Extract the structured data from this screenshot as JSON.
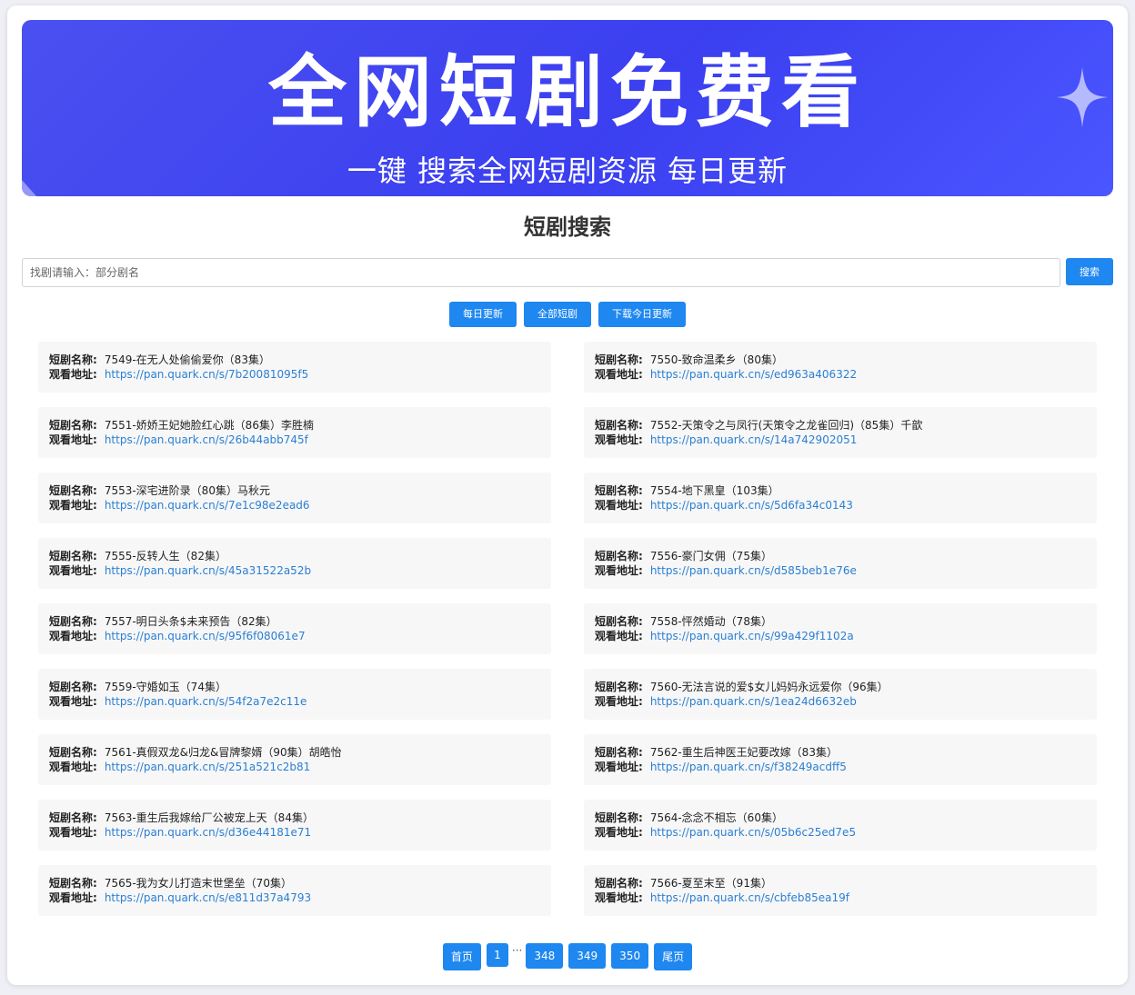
{
  "banner": {
    "title": "全网短剧免费看",
    "subtitle": "一键 搜索全网短剧资源 每日更新"
  },
  "page_title": "短剧搜索",
  "search": {
    "placeholder": "找剧请输入：部分剧名",
    "button_label": "搜索"
  },
  "filters": [
    {
      "label": "每日更新"
    },
    {
      "label": "全部短剧"
    },
    {
      "label": "下载今日更新"
    }
  ],
  "labels": {
    "name": "短剧名称:",
    "address": "观看地址:"
  },
  "items": [
    {
      "title": "7549-在无人处偷偷爱你（83集）",
      "url": "https://pan.quark.cn/s/7b20081095f5"
    },
    {
      "title": "7550-致命温柔乡（80集）",
      "url": "https://pan.quark.cn/s/ed963a406322"
    },
    {
      "title": "7551-娇娇王妃她脸红心跳（86集）李胜楠",
      "url": "https://pan.quark.cn/s/26b44abb745f"
    },
    {
      "title": "7552-天策令之与凤行(天策令之龙雀回归)（85集）千歆",
      "url": "https://pan.quark.cn/s/14a742902051"
    },
    {
      "title": "7553-深宅进阶录（80集）马秋元",
      "url": "https://pan.quark.cn/s/7e1c98e2ead6"
    },
    {
      "title": "7554-地下黑皇（103集）",
      "url": "https://pan.quark.cn/s/5d6fa34c0143"
    },
    {
      "title": "7555-反转人生（82集）",
      "url": "https://pan.quark.cn/s/45a31522a52b"
    },
    {
      "title": "7556-豪门女佣（75集）",
      "url": "https://pan.quark.cn/s/d585beb1e76e"
    },
    {
      "title": "7557-明日头条$未来预告（82集）",
      "url": "https://pan.quark.cn/s/95f6f08061e7"
    },
    {
      "title": "7558-怦然婚动（78集）",
      "url": "https://pan.quark.cn/s/99a429f1102a"
    },
    {
      "title": "7559-守婚如玉（74集）",
      "url": "https://pan.quark.cn/s/54f2a7e2c11e"
    },
    {
      "title": "7560-无法言说的爱$女儿妈妈永远爱你（96集）",
      "url": "https://pan.quark.cn/s/1ea24d6632eb"
    },
    {
      "title": "7561-真假双龙&归龙&冒牌黎婿（90集）胡皓怡",
      "url": "https://pan.quark.cn/s/251a521c2b81"
    },
    {
      "title": "7562-重生后神医王妃要改嫁（83集）",
      "url": "https://pan.quark.cn/s/f38249acdff5"
    },
    {
      "title": "7563-重生后我嫁给厂公被宠上天（84集）",
      "url": "https://pan.quark.cn/s/d36e44181e71"
    },
    {
      "title": "7564-念念不相忘（60集）",
      "url": "https://pan.quark.cn/s/05b6c25ed7e5"
    },
    {
      "title": "7565-我为女儿打造末世堡垒（70集）",
      "url": "https://pan.quark.cn/s/e811d37a4793"
    },
    {
      "title": "7566-夏至末至（91集）",
      "url": "https://pan.quark.cn/s/cbfeb85ea19f"
    }
  ],
  "pagination": {
    "first": "首页",
    "pages": [
      "1",
      "348",
      "349",
      "350"
    ],
    "ellipsis": "···",
    "last": "尾页"
  },
  "colors": {
    "banner": "#3b3ff0",
    "button": "#1e87f0",
    "link": "#2b7fd1",
    "card": "#f7f7f8"
  },
  "icons": [
    "sparkle-icon"
  ]
}
